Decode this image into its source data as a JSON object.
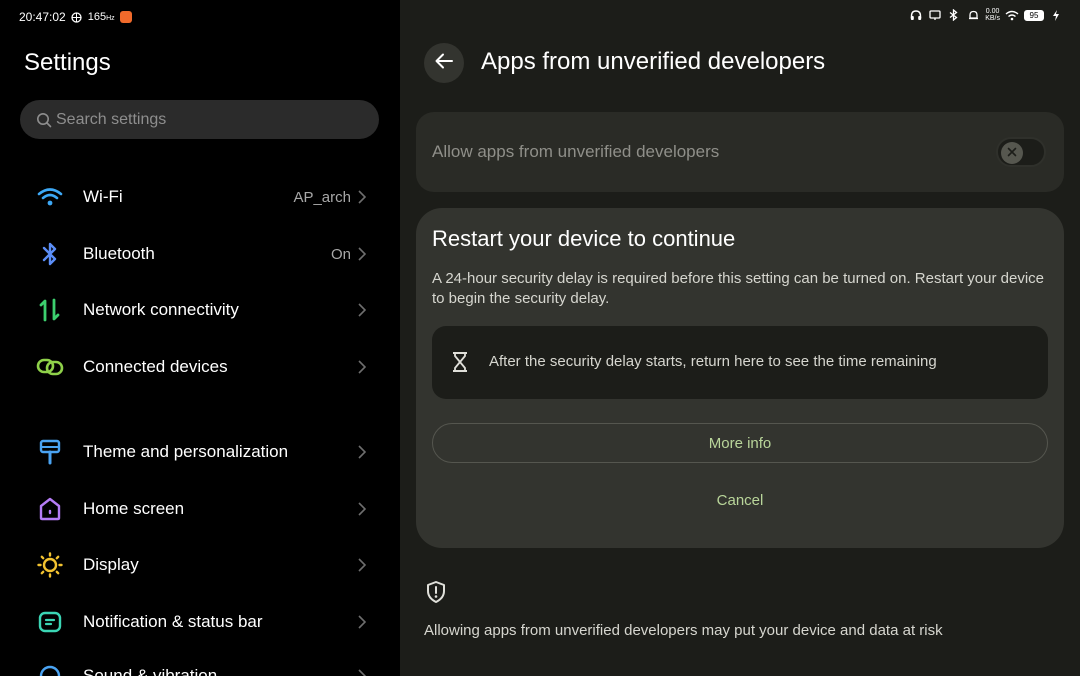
{
  "status_bar": {
    "time": "20:47:02",
    "refresh_rate": "165",
    "refresh_unit": "Hz",
    "net_speed": "0.00",
    "net_speed_unit": "KB/s",
    "battery": "95"
  },
  "sidebar": {
    "title": "Settings",
    "search_placeholder": "Search settings",
    "items": [
      {
        "label": "Wi-Fi",
        "value": "AP_arch",
        "icon": "wifi-icon"
      },
      {
        "label": "Bluetooth",
        "value": "On",
        "icon": "bluetooth-icon"
      },
      {
        "label": "Network connectivity",
        "value": "",
        "icon": "network-icon"
      },
      {
        "label": "Connected devices",
        "value": "",
        "icon": "connected-devices-icon"
      },
      {
        "label": "Theme and personalization",
        "value": "",
        "icon": "theme-brush-icon"
      },
      {
        "label": "Home screen",
        "value": "",
        "icon": "home-icon"
      },
      {
        "label": "Display",
        "value": "",
        "icon": "sun-icon"
      },
      {
        "label": "Notification & status bar",
        "value": "",
        "icon": "notification-icon"
      },
      {
        "label": "Sound & vibration",
        "value": "",
        "icon": "sound-icon"
      }
    ]
  },
  "main": {
    "title": "Apps from unverified developers",
    "toggle_label": "Allow apps from unverified developers",
    "toggle_on": false,
    "dialog": {
      "title": "Restart your device to continue",
      "body": "A 24-hour security delay is required before this setting can be turned on. Restart your device to begin the security delay.",
      "info": "After the security delay starts, return here to see the time remaining",
      "more_info_label": "More info",
      "cancel_label": "Cancel"
    },
    "risk_text": "Allowing apps from unverified developers may put your device and data at risk"
  },
  "colors": {
    "accent": "#b9d59a",
    "wifi": "#3da8f5",
    "bluetooth": "#5b8ef7",
    "network": "#3ccf6e",
    "connected": "#8fd14a",
    "theme": "#4aa3f2",
    "home": "#b57cf5",
    "display": "#f2c230",
    "notification": "#3bd6b5"
  }
}
